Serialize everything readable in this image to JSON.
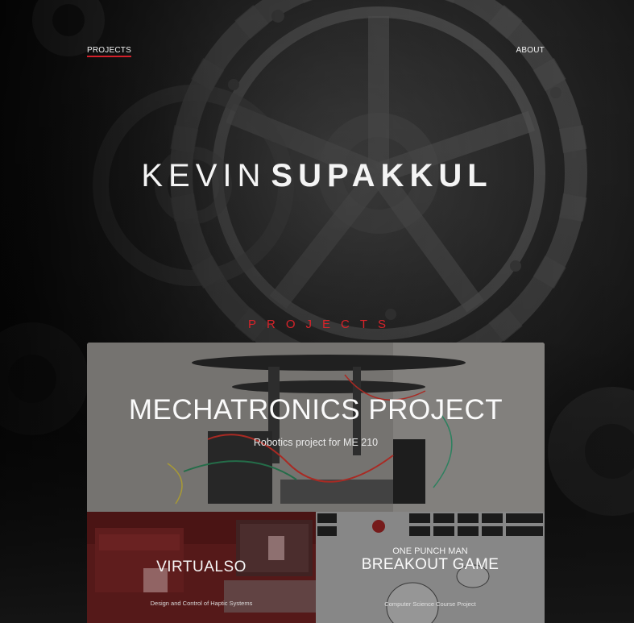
{
  "nav": {
    "projects_label": "PROJECTS",
    "about_label": "ABOUT"
  },
  "hero": {
    "first_name": "KEVIN",
    "last_name": "SUPAKKUL"
  },
  "projects_section": {
    "title": "PROJECTS",
    "cards": [
      {
        "title": "MECHATRONICS PROJECT",
        "subtitle": "Robotics project for ME 210"
      },
      {
        "title": "VIRTUALSO",
        "subtitle": "Design and Control of Haptic Systems"
      },
      {
        "pretitle": "ONE PUNCH MAN",
        "title": "BREAKOUT GAME",
        "subtitle": "Computer Science Course Project"
      }
    ]
  },
  "colors": {
    "accent": "#d8232a",
    "background": "#0e0e0e"
  },
  "icons": [
    "gear-background"
  ]
}
